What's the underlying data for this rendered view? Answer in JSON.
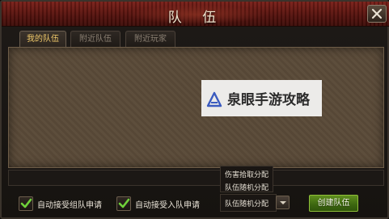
{
  "window": {
    "title": "队 伍"
  },
  "tabs": [
    {
      "label": "我的队伍",
      "active": true
    },
    {
      "label": "附近队伍",
      "active": false
    },
    {
      "label": "附近玩家",
      "active": false
    }
  ],
  "watermark": {
    "text": "泉眼手游攻略"
  },
  "options": {
    "auto_accept_group": {
      "label": "自动接受组队申请",
      "checked": true
    },
    "auto_accept_join": {
      "label": "自动接受入队申请",
      "checked": true
    }
  },
  "distribution": {
    "options": [
      "伤害拾取分配",
      "队伍随机分配"
    ],
    "selected": "队伍随机分配"
  },
  "buttons": {
    "create_team": "创建队伍"
  },
  "icons": {
    "close": "close-icon",
    "checkmark": "checkmark-icon",
    "dropdown": "chevron-down-icon",
    "watermark_logo": "triangle-logo-icon"
  },
  "colors": {
    "title_bar": "#5e150f",
    "active_tab_text": "#f0c96a",
    "panel_bg": "#5a4a38",
    "create_button": "#4a7a15",
    "checkmark": "#6fd13a"
  }
}
